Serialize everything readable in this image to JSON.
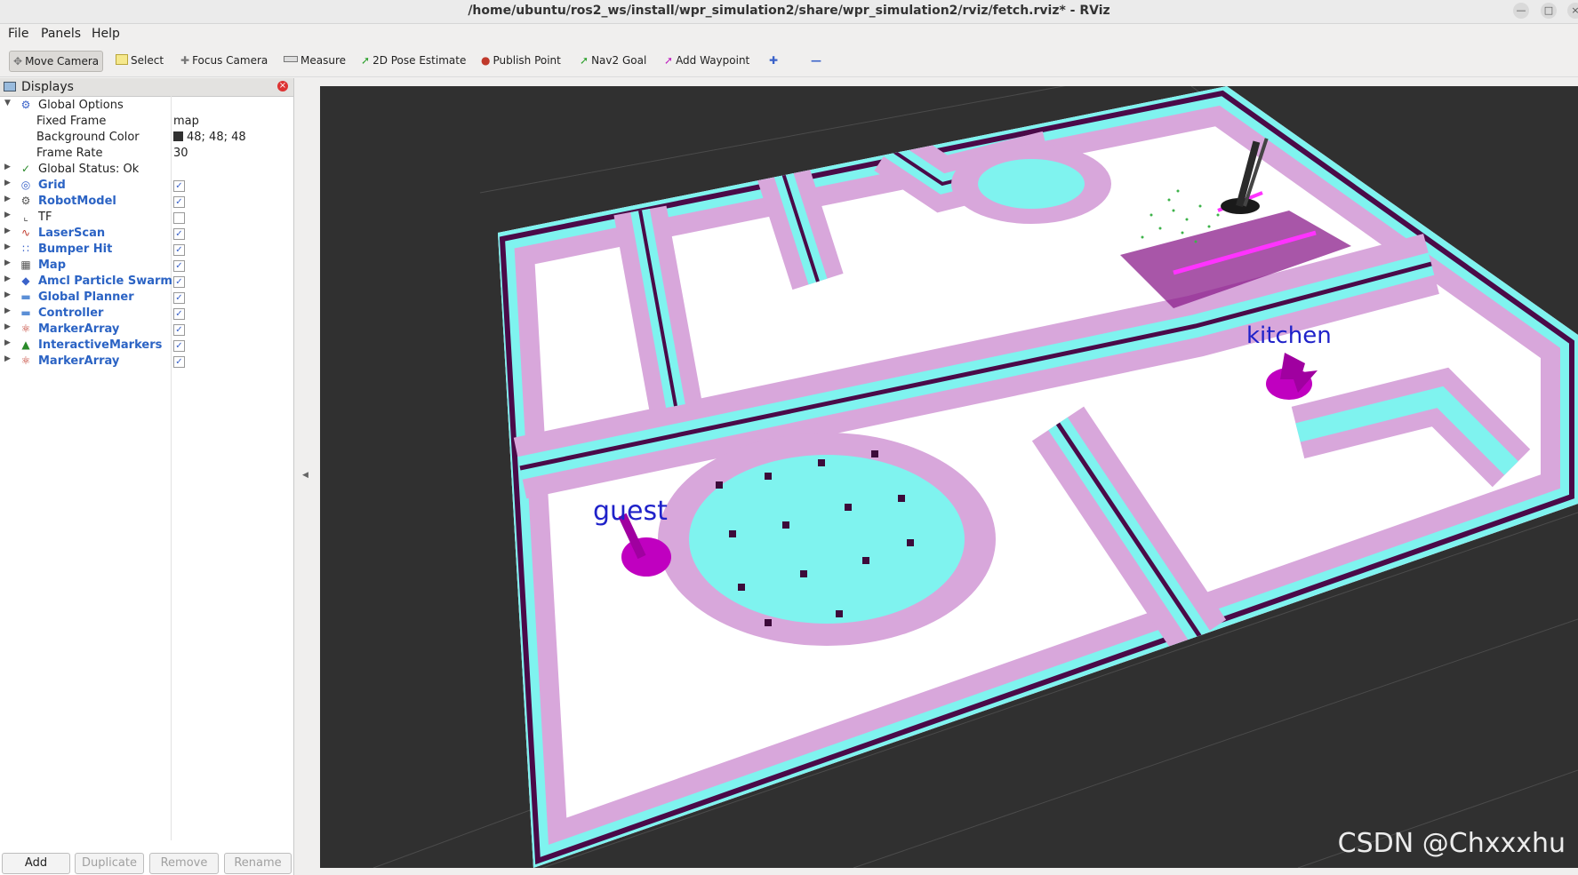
{
  "window": {
    "title": "/home/ubuntu/ros2_ws/install/wpr_simulation2/share/wpr_simulation2/rviz/fetch.rviz* - RViz"
  },
  "menu": {
    "file": "File",
    "panels": "Panels",
    "help": "Help"
  },
  "toolbar": {
    "move_camera": "Move Camera",
    "select": "Select",
    "focus_camera": "Focus Camera",
    "measure": "Measure",
    "pose_estimate": "2D Pose Estimate",
    "publish_point": "Publish Point",
    "nav2_goal": "Nav2 Goal",
    "add_waypoint": "Add Waypoint"
  },
  "displays_panel": {
    "title": "Displays",
    "global_options": "Global Options",
    "fixed_frame_label": "Fixed Frame",
    "fixed_frame_value": "map",
    "bg_color_label": "Background Color",
    "bg_color_value": "48; 48; 48",
    "frame_rate_label": "Frame Rate",
    "frame_rate_value": "30",
    "global_status": "Global Status: Ok",
    "items": [
      {
        "label": "Grid",
        "checked": true
      },
      {
        "label": "RobotModel",
        "checked": true
      },
      {
        "label": "TF",
        "checked": false
      },
      {
        "label": "LaserScan",
        "checked": true
      },
      {
        "label": "Bumper Hit",
        "checked": true
      },
      {
        "label": "Map",
        "checked": true
      },
      {
        "label": "Amcl Particle Swarm",
        "checked": true
      },
      {
        "label": "Global Planner",
        "checked": true
      },
      {
        "label": "Controller",
        "checked": true
      },
      {
        "label": "MarkerArray",
        "checked": true
      },
      {
        "label": "InteractiveMarkers",
        "checked": true
      },
      {
        "label": "MarkerArray",
        "checked": true
      }
    ],
    "buttons": {
      "add": "Add",
      "duplicate": "Duplicate",
      "remove": "Remove",
      "rename": "Rename"
    }
  },
  "viewport": {
    "labels": {
      "guest": "guest",
      "kitchen": "kitchen"
    },
    "watermark": "CSDN @Chxxxhu"
  }
}
